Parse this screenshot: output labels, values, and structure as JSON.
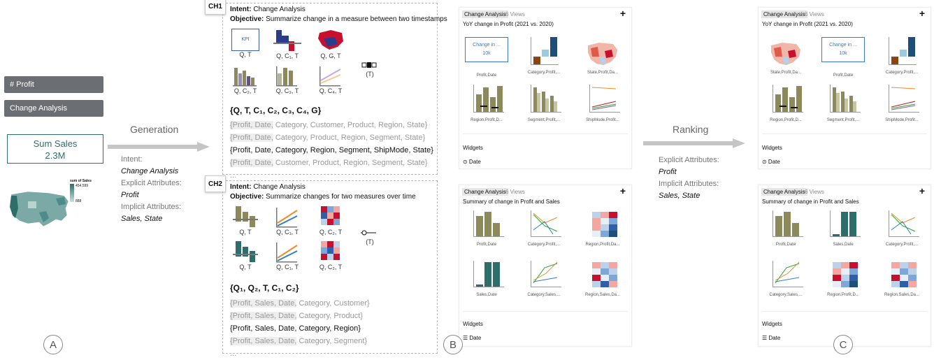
{
  "left": {
    "chip1": "# Profit",
    "chip2": "Change Analysis",
    "kpi_label": "Sum Sales",
    "kpi_value": "2.3M",
    "map_legend_title": "sum of Sales",
    "map_legend_max": "454,599",
    "map_legend_min": "888",
    "marker": "A"
  },
  "generation": {
    "label": "Generation",
    "intent_label": "Intent:",
    "intent_value": "Change Analysis",
    "explicit_label": "Explicit Attributes:",
    "explicit_value": "Profit",
    "implicit_label": "Implicit Attributes:",
    "implicit_value": "Sales, State"
  },
  "ch1": {
    "tag": "CH1",
    "intent_label": "Intent:",
    "intent_value": "Change Analysis",
    "objective_label": "Objective:",
    "objective_value": "Summarize change in a measure between two timestamps",
    "cells": [
      "Q, T",
      "Q, C₁, T",
      "Q, G, T",
      "Q, C₂, T",
      "Q, C₃, T",
      "Q, C₄, T"
    ],
    "kpi_text": "KPI",
    "widget_label": "(T)",
    "formula": "{Q, T, C₁, C₂, C₃, C₄, G}",
    "rows": [
      {
        "p": "{Profit, Date,",
        "r": " Category, Customer, Product, Region, State}"
      },
      {
        "p": "{Profit, Date,",
        "r": " Category, Product, Region, Segment, State}"
      },
      {
        "p": "{Profit, Date,",
        "r": " Category, Region, Segment, ShipMode, State}"
      },
      {
        "p": "{Profit, Date,",
        "r": " Customer, Product, Region, Segment, State}"
      }
    ],
    "more": "..."
  },
  "ch2": {
    "tag": "CH2",
    "intent_label": "Intent:",
    "intent_value": "Change Analysis",
    "objective_label": "Objective:",
    "objective_value": "Summarize changes for two measures over time",
    "cells": [
      "Q, T",
      "Q, C₁, T",
      "Q, C₂, T",
      "Q, T",
      "Q, C₁, T",
      "Q, C₂, T"
    ],
    "widget_label": "(T)",
    "formula": "{Q₁, Q₂, T, C₁, C₂}",
    "rows": [
      {
        "p": "{Profit, Sales, Date,",
        "r": " Category, Customer}"
      },
      {
        "p": "{Profit, Sales, Date,",
        "r": " Category, Product}"
      },
      {
        "p": "{Profit, Sales, Date,",
        "r": " Category, Region}"
      },
      {
        "p": "{Profit, Sales, Date,",
        "r": " Category, Segment}"
      }
    ],
    "more": "..."
  },
  "ranking": {
    "label": "Ranking",
    "explicit_label": "Explicit Attributes:",
    "explicit_value": "Profit",
    "implicit_label": "Implicit Attributes:",
    "implicit_value": "Sales, State"
  },
  "panelB1": {
    "tag": "Change Analysis",
    "views": "6 Views",
    "plus": "+",
    "title": "YoY change in Profit (2021 vs. 2020)",
    "kpi_text": "Change in ...",
    "kpi_value": "10k",
    "thumbs": [
      "Profit,Date",
      "Category,Profit,...",
      "State,Profit,Da...",
      "Region,Profit,D...",
      "Segment,Profit,...",
      "ShipMode,Profit..."
    ],
    "widgets": "Widgets",
    "date": "⊙ Date"
  },
  "panelB2": {
    "tag": "Change Analysis",
    "views": "6 Views",
    "plus": "+",
    "title": "Summary of change in Profit and Sales",
    "thumbs": [
      "Profit,Date",
      "Category,Profit,...",
      "Region,Profit,Da...",
      "Sales,Date",
      "Category,Sales,...",
      "Region,Sales,Da..."
    ],
    "widgets": "Widgets",
    "date": "☰ Date"
  },
  "panelC1": {
    "tag": "Change Analysis",
    "views": "6 Views",
    "plus": "+",
    "title": "YoY change in Profit (2021 vs. 2020)",
    "kpi_text": "Change in ...",
    "kpi_value": "10k",
    "thumbs": [
      "State,Profit,Da...",
      "Profit,Date",
      "Category,Profit,...",
      "Region,Profit,D...",
      "Segment,Profit,...",
      "ShipMode,Profit..."
    ],
    "widgets": "Widgets",
    "date": "⊙ Date"
  },
  "panelC2": {
    "tag": "Change Analysis",
    "views": "6 Views",
    "plus": "+",
    "title": "Summary of change in Profit and Sales",
    "thumbs": [
      "Profit,Date",
      "Sales,Date",
      "Category,Profit,...",
      "Category,Sales,...",
      "Region,Profit,D...",
      "Region,Sales,Da..."
    ],
    "widgets": "Widgets",
    "date": "☰ Date"
  },
  "markers": {
    "b": "B",
    "c": "C"
  },
  "colors": {
    "olive": "#8c8a5a",
    "teal": "#2e6e6a",
    "gray": "#6b6e72",
    "red": "#c8102e",
    "navy": "#2b3c8a"
  }
}
